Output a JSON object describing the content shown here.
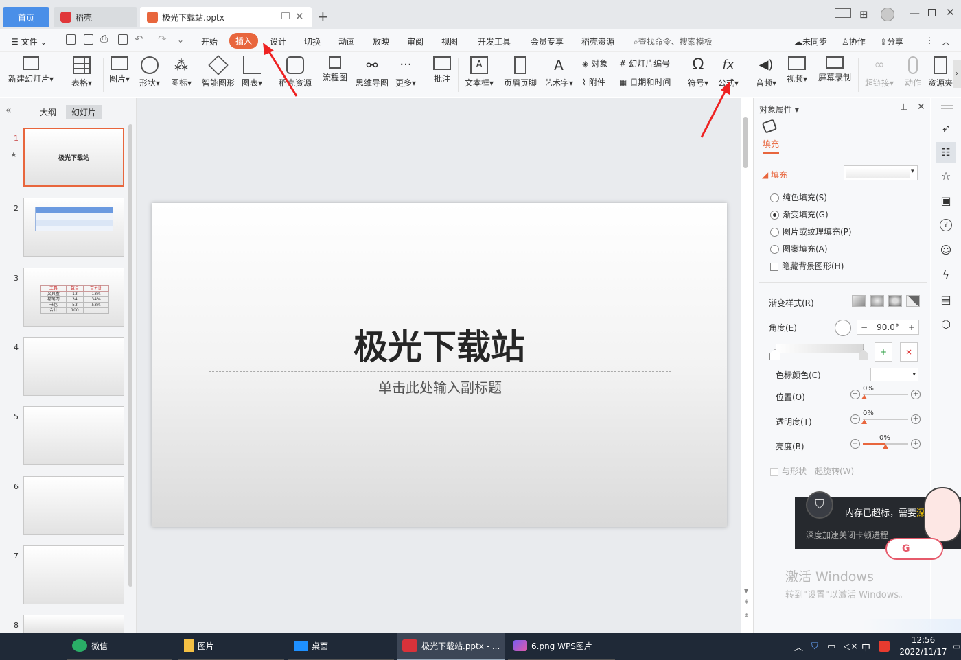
{
  "tabs": {
    "home": "首页",
    "daoke": "稻壳",
    "doc": "极光下载站.pptx"
  },
  "menu": {
    "file": "文件",
    "items": [
      "开始",
      "插入",
      "设计",
      "切换",
      "动画",
      "放映",
      "审阅",
      "视图",
      "开发工具",
      "会员专享",
      "稻壳资源"
    ],
    "search": "查找命令、搜索模板",
    "sync": "未同步",
    "collab": "协作",
    "share": "分享"
  },
  "ribbon": {
    "new_slide": "新建幻灯片",
    "table": "表格",
    "picture": "图片",
    "shape": "形状",
    "icon": "图标",
    "smart": "智能图形",
    "chart": "图表",
    "resource": "稻壳资源",
    "flow": "流程图",
    "mind": "思维导图",
    "more": "更多",
    "comment": "批注",
    "textbox": "文本框",
    "header": "页眉页脚",
    "wordart": "艺术字",
    "object": "对象",
    "attach": "附件",
    "slide_num": "幻灯片编号",
    "datetime": "日期和时间",
    "symbol": "符号",
    "formula": "公式",
    "audio": "音频",
    "video": "视频",
    "record": "屏幕录制",
    "link": "超链接",
    "action": "动作",
    "res_more": "资源夹"
  },
  "left": {
    "outline": "大纲",
    "slides": "幻灯片",
    "thumb1_title": "极光下载站",
    "slide_numbers": [
      "1",
      "2",
      "3",
      "4",
      "5",
      "6",
      "7",
      "8"
    ],
    "table3": [
      [
        "工具",
        "数目",
        "百分比"
      ],
      [
        "文具盒",
        "13",
        "13%"
      ],
      [
        "卷笔刀",
        "34",
        "34%"
      ],
      [
        "书包",
        "53",
        "53%"
      ],
      [
        "合计",
        "100",
        ""
      ]
    ]
  },
  "slide": {
    "title": "极光下载站",
    "subtitle": "单击此处输入副标题"
  },
  "panel": {
    "header": "对象属性",
    "tab": "填充",
    "section": "填充",
    "opt1": "纯色填充(S)",
    "opt2": "渐变填充(G)",
    "opt3": "图片或纹理填充(P)",
    "opt4": "图案填充(A)",
    "opt5": "隐藏背景图形(H)",
    "grad_style": "渐变样式(R)",
    "angle_label": "角度(E)",
    "angle_value": "90.0°",
    "stop_color": "色标颜色(C)",
    "pos": "位置(O)",
    "pos_v": "0%",
    "trans": "透明度(T)",
    "trans_v": "0%",
    "bright": "亮度(B)",
    "bright_v": "0%",
    "rotate": "与形状一起旋转(W)"
  },
  "popup": {
    "title": "内存已超标，需要",
    "accent": "深",
    "sub": "深度加速关闭卡顿进程"
  },
  "watermark": {
    "line1": "激活 Windows",
    "line2": "转到\"设置\"以激活 Windows。"
  },
  "taskbar": {
    "wechat": "微信",
    "pics": "图片",
    "desktop": "桌面",
    "ppt": "极光下载站.pptx - ...",
    "png": "6.png WPS图片",
    "time": "12:56",
    "date": "2022/11/17",
    "ime": "中"
  },
  "colors": {
    "accent": "#e8663d",
    "tab_blue": "#4a90e2"
  }
}
